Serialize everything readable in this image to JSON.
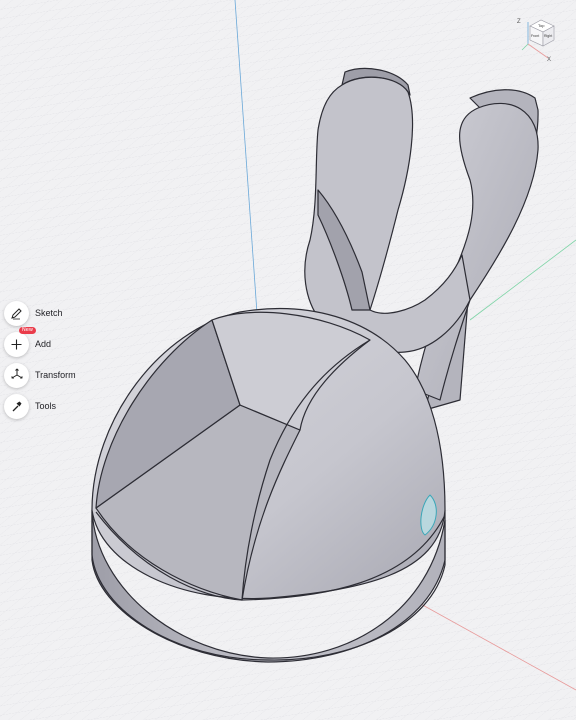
{
  "toolbar": {
    "items": [
      {
        "label": "Sketch",
        "icon": "pen-icon"
      },
      {
        "label": "Add",
        "icon": "plus-icon",
        "badge": "New"
      },
      {
        "label": "Transform",
        "icon": "transform-arrows-icon"
      },
      {
        "label": "Tools",
        "icon": "wrench-hammer-icon"
      }
    ]
  },
  "viewcube": {
    "faces": [
      "Top",
      "Front",
      "Right"
    ],
    "axes": [
      "Z",
      "X",
      "Y"
    ]
  },
  "colors": {
    "canvas_background": "#f1f1f3",
    "grid_line": "#e0e0e4",
    "model_face": "#c9c9d0",
    "model_edge": "#2d2d35",
    "axis_y_blue": "#6aa8d8",
    "axis_z_green": "#7ed4a6",
    "axis_x_red": "#e89a9a",
    "badge_red": "#ea3b4a"
  }
}
